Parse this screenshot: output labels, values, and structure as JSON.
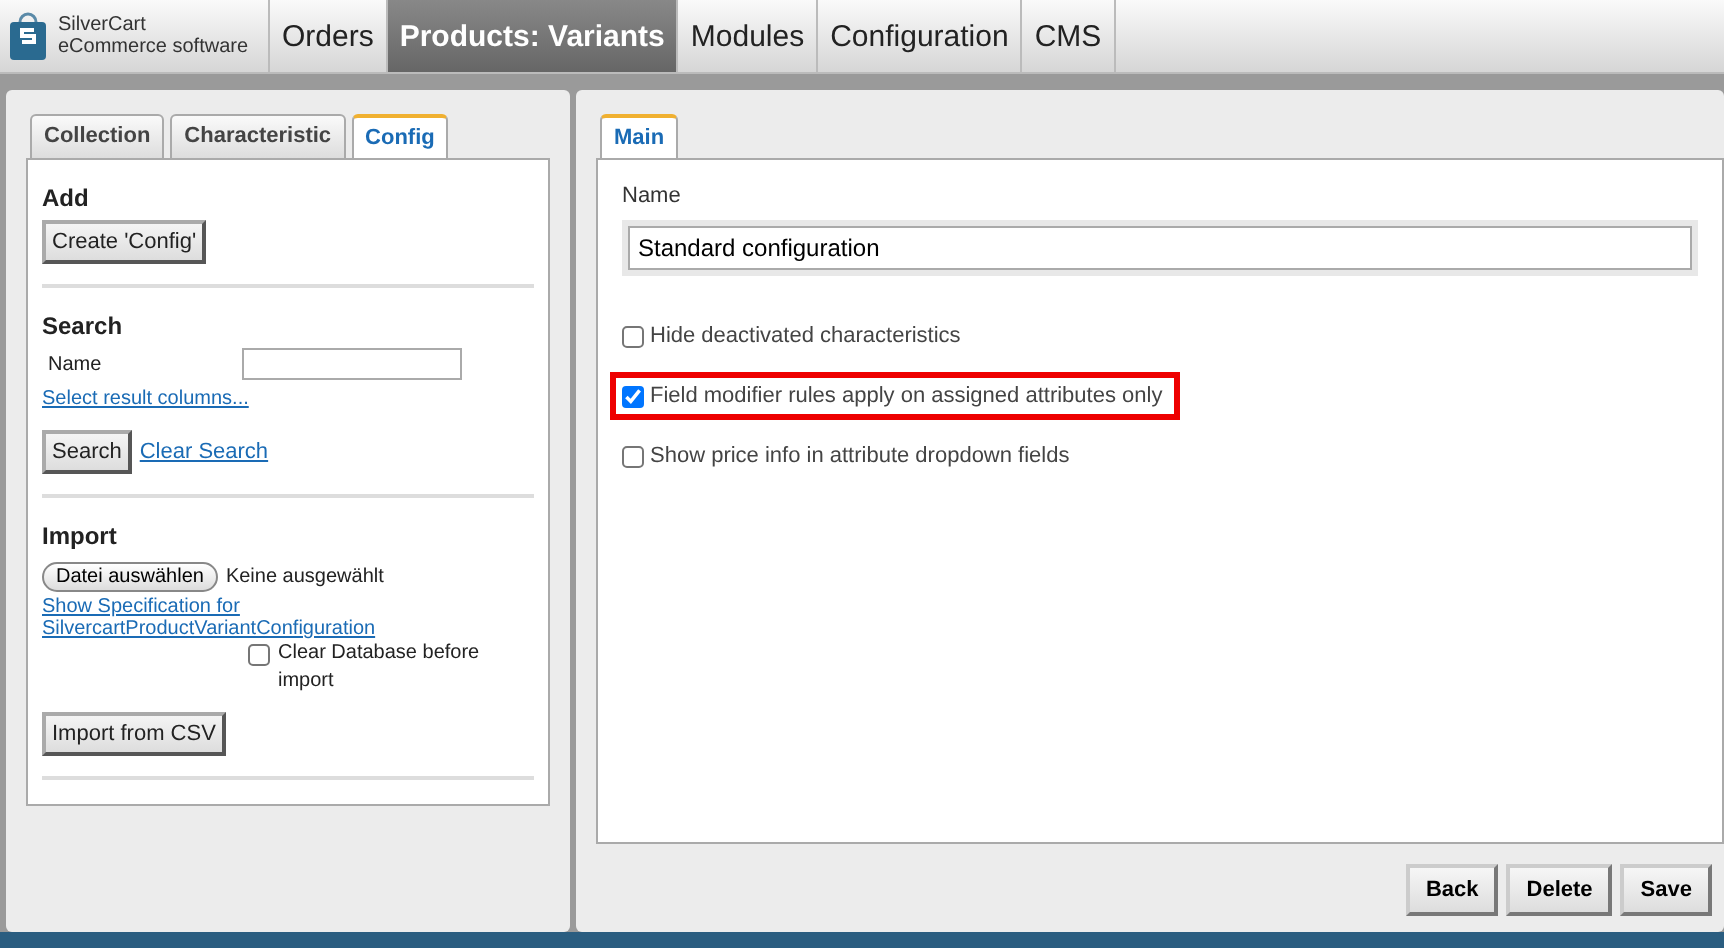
{
  "logo": {
    "line1": "SilverCart",
    "line2": "eCommerce software"
  },
  "nav": [
    {
      "label": "Orders",
      "selected": false
    },
    {
      "label": "Products: Variants",
      "selected": true
    },
    {
      "label": "Modules",
      "selected": false
    },
    {
      "label": "Configuration",
      "selected": false
    },
    {
      "label": "CMS",
      "selected": false
    }
  ],
  "left_tabs": [
    {
      "label": "Collection",
      "selected": false
    },
    {
      "label": "Characteristic",
      "selected": false
    },
    {
      "label": "Config",
      "selected": true
    }
  ],
  "add": {
    "heading": "Add",
    "button": "Create 'Config'"
  },
  "search": {
    "heading": "Search",
    "name_label": "Name",
    "columns_link": "Select result columns...",
    "button": "Search",
    "clear_link": "Clear Search"
  },
  "import": {
    "heading": "Import",
    "file_button": "Datei auswählen",
    "file_status": "Keine ausgewählt",
    "spec_link": "Show Specification for SilvercartProductVariantConfiguration",
    "clear_label": "Clear Database before import",
    "clear_checked": false,
    "button": "Import from CSV"
  },
  "main_tabs": [
    {
      "label": "Main",
      "selected": true
    }
  ],
  "form": {
    "name_label": "Name",
    "name_value": "Standard configuration",
    "options": [
      {
        "label": "Hide deactivated characteristics",
        "checked": false,
        "highlighted": false
      },
      {
        "label": "Field modifier rules apply on assigned attributes only",
        "checked": true,
        "highlighted": true
      },
      {
        "label": "Show price info in attribute dropdown fields",
        "checked": false,
        "highlighted": false
      }
    ]
  },
  "actions": [
    "Back",
    "Delete",
    "Save"
  ]
}
